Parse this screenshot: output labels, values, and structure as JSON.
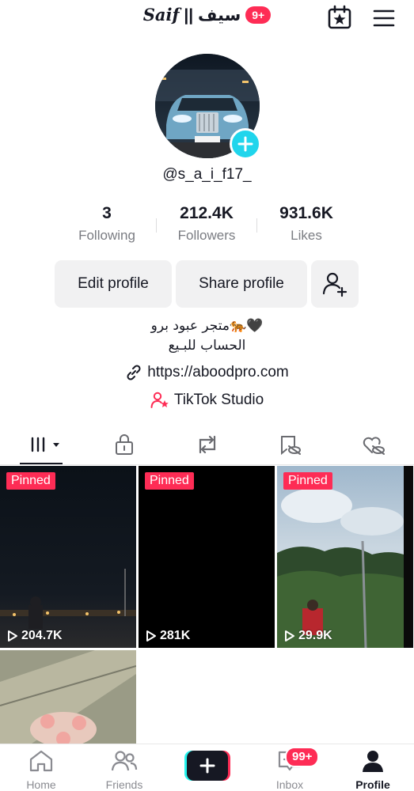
{
  "header": {
    "title_latin": "Saif",
    "title_separator": "||",
    "title_arabic": "سيف",
    "notification_badge": "9+"
  },
  "profile": {
    "username": "@s_a_i_f17_"
  },
  "stats": [
    {
      "value": "3",
      "label": "Following"
    },
    {
      "value": "212.4K",
      "label": "Followers"
    },
    {
      "value": "931.6K",
      "label": "Likes"
    }
  ],
  "actions": {
    "edit_profile": "Edit profile",
    "share_profile": "Share profile"
  },
  "bio": {
    "line1": "متجر عبود برو🐅🖤",
    "line2": "الحساب للبـيع",
    "link": "https://aboodpro.com",
    "studio": "TikTok Studio"
  },
  "videos": [
    {
      "pinned": "Pinned",
      "views": "204.7K"
    },
    {
      "pinned": "Pinned",
      "views": "281K"
    },
    {
      "pinned": "Pinned",
      "views": "29.9K"
    },
    {
      "pinned": "",
      "views": ""
    }
  ],
  "nav": {
    "home": "Home",
    "friends": "Friends",
    "inbox": "Inbox",
    "profile": "Profile",
    "inbox_badge": "99+"
  },
  "colors": {
    "accent": "#fe2c55",
    "add_avatar": "#20d5ec",
    "text": "#161823",
    "muted": "#7a7c82"
  }
}
